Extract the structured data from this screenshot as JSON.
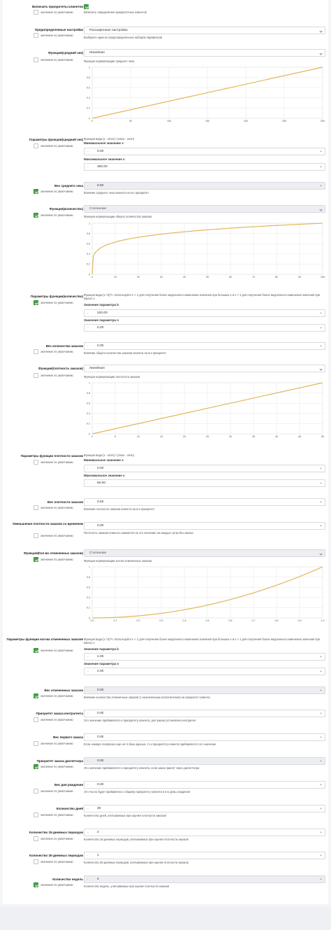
{
  "default_label": "значение по умолчанию",
  "fields": [
    {
      "label": "Включить приоритеты клиентов",
      "checked": true,
      "help": "Включить определение приоритетных клиентов"
    },
    {
      "label": "Предопределенные настройки",
      "checked": false,
      "select": "Расширенная настройка",
      "help": "Выберите один из предопределенных наборов параметров"
    },
    {
      "label": "Функция(средний чек)",
      "checked": false,
      "select": "Линейная",
      "help": "Функция нормализации среднего чека"
    },
    {
      "label": "Параметры функции(средний чек)",
      "checked": false,
      "help": "Функция вида (x - xmin) / (xmax - xmin)",
      "sub1": "Минимальное значение x",
      "val1": "0.00",
      "sub2": "Максимальное значение x",
      "val2": "300.00"
    },
    {
      "label": "Вес среднего чека",
      "checked": true,
      "value": "0.50",
      "help": "Влияние среднего чека клиента на его приоритет"
    },
    {
      "label": "Функция(количество)",
      "checked": true,
      "select": "Степенная",
      "help": "Функция нормализации общего количества заказов"
    },
    {
      "label": "Параметры функции(количество)",
      "checked": true,
      "help": "Функция вида (x / b)^n. Используйте n < 1 для получения более медленного изменения значения при больших x и n > 1 для получения более медленного изменения значения при малых x",
      "sub1": "Значение параметра b",
      "val1": "100.00",
      "sub2": "Значение параметра n",
      "val2": "0.20"
    },
    {
      "label": "Вес количества заказов",
      "checked": false,
      "value": "0.00",
      "help": "Влияние общего количества заказов клиента на его приоритет"
    },
    {
      "label": "Функция(плотность заказов)",
      "checked": false,
      "select": "Линейная",
      "help": "Функция нормализации плотности заказов"
    },
    {
      "label": "Параметры функции плотности заказов",
      "checked": false,
      "help": "Функция вида (x - xmin) / (xmax - xmin)",
      "sub1": "Минимальное значение x",
      "val1": "0.00",
      "sub2": "Максимальное значение x",
      "val2": "50.00"
    },
    {
      "label": "Вес плотности заказов",
      "checked": false,
      "value": "0.50",
      "help": "Влияние плотности заказов клиента на его приоритет"
    },
    {
      "label": "Уменьшение плотности заказов со временем",
      "checked": false,
      "value": "0.00",
      "help": "Плотность заказов клиента снижается на это значение на каждые сутки без заказа"
    },
    {
      "label": "Функция(Кол-во отмененных заказов)",
      "checked": true,
      "select": "Степенная",
      "help": "Функция нормализации кол-ва отмененных заказов"
    },
    {
      "label": "Параметры функции кол-ва отмененных заказов",
      "checked": true,
      "help": "Функция вида (x / b)^n. Используйте n < 1 для получения более медленного изменения значения при больших x и n > 1 для получения более медленного изменения значения при малых x",
      "sub1": "Значение параметра b",
      "val1": "1.00",
      "sub2": "Значение параметра n",
      "val2": "2.00"
    },
    {
      "label": "Вес отмененных заказов",
      "checked": true,
      "value": "0.00",
      "help": "Влияние количества отмененных заказов (с назначенным исполнителем) на приоритет клиента"
    },
    {
      "label": "Приоритет заказа контрагента",
      "checked": false,
      "value": "0.00",
      "help": "Это значение прибавляется к приоритету клиента, для заказа установлен контрагент"
    },
    {
      "label": "Вес первого заказа",
      "checked": false,
      "value": "0.00",
      "help": "Если номера телефона еще нет в базе данных, то к приоритету клиента прибавляется это значение"
    },
    {
      "label": "Приоритет заказа диспетчера",
      "checked": true,
      "value": "0.00",
      "help": "Это значение прибавляется к приоритету клиента, если заказ принят через диспетчера"
    },
    {
      "label": "Вес дня рождения",
      "checked": false,
      "value": "0.00",
      "help": "Это число будет прибавлено к общему приоритету клиента в его день рождения"
    },
    {
      "label": "Количество дней",
      "checked": false,
      "value": "30",
      "help": "Количество дней, учитываемых при оценке плотности заказов"
    },
    {
      "label": "Количество 15-дневных периодов",
      "checked": false,
      "value": "2",
      "help": "Количество 15-дневных периодов, учитываемых при оценке плотности заказов"
    },
    {
      "label": "Количество 30-дневных периодов",
      "checked": false,
      "value": "1",
      "help": "Количество 30-дневных периодов, учитываемых при оценке плотности заказов"
    },
    {
      "label": "Количество недель",
      "checked": true,
      "value": "4",
      "help": "Количество недель, учитываемых при оценке плотности заказов"
    }
  ],
  "chart_data": [
    {
      "type": "line",
      "function": "linear",
      "x": [
        0,
        300
      ],
      "y": [
        0,
        1
      ],
      "xlim": [
        0,
        300
      ],
      "ylim": [
        0,
        1
      ],
      "xticks": [
        "0",
        "50",
        "100",
        "150",
        "200",
        "250",
        "300"
      ],
      "yticks": [
        "0",
        "0.2",
        "0.4",
        "0.6",
        "0.8",
        "1"
      ],
      "color": "#e3b65c"
    },
    {
      "type": "line",
      "function": "power",
      "b": 100,
      "n": 0.2,
      "xlim": [
        0,
        100
      ],
      "ylim": [
        0,
        1
      ],
      "xticks": [
        "0",
        "10",
        "20",
        "30",
        "40",
        "50",
        "60",
        "70",
        "80",
        "90",
        "100"
      ],
      "yticks": [
        "0",
        "0.2",
        "0.4",
        "0.6",
        "0.8",
        "1"
      ],
      "color": "#e3b65c"
    },
    {
      "type": "line",
      "function": "linear",
      "x": [
        0,
        50
      ],
      "y": [
        0,
        1
      ],
      "xlim": [
        0,
        50
      ],
      "ylim": [
        0,
        1
      ],
      "xticks": [
        "0",
        "5",
        "10",
        "15",
        "20",
        "25",
        "30",
        "35",
        "40",
        "45",
        "50"
      ],
      "yticks": [
        "0",
        "0.2",
        "0.4",
        "0.6",
        "0.8",
        "1"
      ],
      "color": "#e3b65c"
    },
    {
      "type": "line",
      "function": "power",
      "b": 1,
      "n": 2,
      "xlim": [
        0,
        1
      ],
      "ylim": [
        0,
        1
      ],
      "xticks": [
        "0.0",
        "0.1",
        "0.2",
        "0.3",
        "0.4",
        "0.5",
        "0.6",
        "0.7",
        "0.8",
        "0.9",
        "1.0"
      ],
      "yticks": [
        "0",
        "0.2",
        "0.4",
        "0.6",
        "0.8",
        "1"
      ],
      "color": "#e3b65c"
    }
  ]
}
